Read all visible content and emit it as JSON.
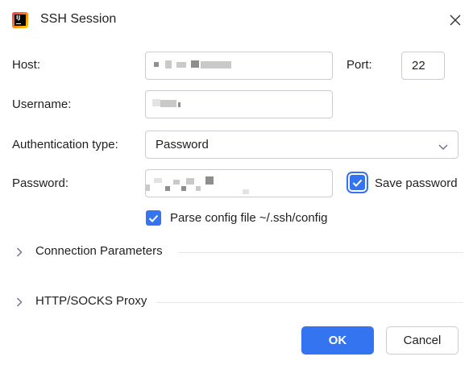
{
  "window": {
    "title": "SSH Session"
  },
  "form": {
    "host_label": "Host:",
    "port_label": "Port:",
    "port_value": "22",
    "username_label": "Username:",
    "auth_label": "Authentication type:",
    "auth_value": "Password",
    "password_label": "Password:",
    "save_password_label": "Save password",
    "save_password_checked": true,
    "parse_config_label": "Parse config file ~/.ssh/config",
    "parse_config_checked": true
  },
  "sections": [
    {
      "label": "Connection Parameters",
      "expanded": false
    },
    {
      "label": "HTTP/SOCKS Proxy",
      "expanded": false
    }
  ],
  "buttons": {
    "ok": "OK",
    "cancel": "Cancel"
  },
  "colors": {
    "accent": "#3574f0",
    "border": "#c9ccd1",
    "text": "#1f1f1f"
  }
}
